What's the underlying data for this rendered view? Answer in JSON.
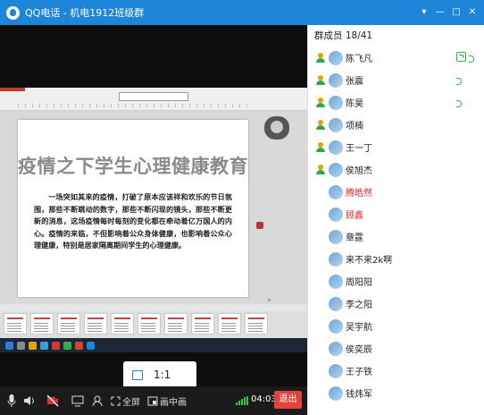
{
  "window": {
    "title": "QQ电话 - 机电1912班级群",
    "buttons": [
      "▾",
      "—",
      "□",
      "✕"
    ]
  },
  "slide": {
    "title": "疫情之下学生心理健康教育",
    "body": "一场突如其来的疫情，打破了原本应该祥和欢乐的节日氛围，那些不断跳动的数字，那些不断闪现的镜头，那些不断更新的消息，这场疫情每时每刻的变化都在牵动着亿万国人的内心。疫情的来临，不但影响着公众身体健康，也影响着公众心理健康，特别是居家隔离期间学生的心理健康。"
  },
  "zoom": {
    "label": "1:1"
  },
  "toolbar": {
    "fullscreen_label": "全屏",
    "pip_label": "画中画",
    "timer": "04:03",
    "exit_label": "退出"
  },
  "members_header": "群成员 18/41",
  "members": [
    {
      "name": "陈飞凡",
      "red": false,
      "indicator": "share"
    },
    {
      "name": "张震",
      "red": false,
      "indicator": "voice"
    },
    {
      "name": "陈昊",
      "red": false,
      "indicator": "voice"
    },
    {
      "name": "项楠",
      "red": false,
      "indicator": ""
    },
    {
      "name": "王一丁",
      "red": false,
      "indicator": ""
    },
    {
      "name": "侯旭杰",
      "red": false,
      "indicator": ""
    },
    {
      "name": "腾皓然",
      "red": true,
      "indicator": ""
    },
    {
      "name": "顾鑫",
      "red": true,
      "indicator": ""
    },
    {
      "name": "章霆",
      "red": false,
      "indicator": ""
    },
    {
      "name": "来不来2k啊",
      "red": false,
      "indicator": ""
    },
    {
      "name": "周阳阳",
      "red": false,
      "indicator": ""
    },
    {
      "name": "李之阳",
      "red": false,
      "indicator": ""
    },
    {
      "name": "吴宇航",
      "red": false,
      "indicator": ""
    },
    {
      "name": "侯奕辰",
      "red": false,
      "indicator": ""
    },
    {
      "name": "王子铁",
      "red": false,
      "indicator": ""
    },
    {
      "name": "钱炜军",
      "red": false,
      "indicator": ""
    }
  ],
  "colors": {
    "accent": "#1e86d8",
    "exit": "#e0443d",
    "active": "#2cb34a",
    "red_name": "#e0232f"
  }
}
